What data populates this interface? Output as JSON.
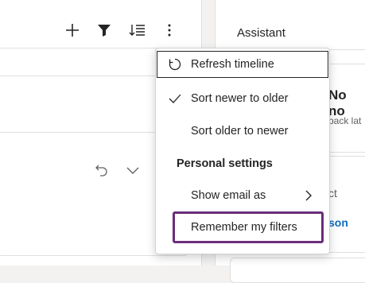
{
  "assistant": {
    "title": "Assistant",
    "card1_heading": "No no",
    "card1_subtext": "back lat",
    "card2_text": "ct",
    "card2_link": "son"
  },
  "menu": {
    "items": [
      {
        "label": "Refresh timeline",
        "icon": "refresh-icon"
      },
      {
        "label": "Sort newer to older",
        "icon": "checkmark-icon",
        "checked": true
      },
      {
        "label": "Sort older to newer"
      }
    ],
    "section_heading": "Personal settings",
    "show_email_label": "Show email as",
    "remember_filters_label": "Remember my filters"
  },
  "colors": {
    "accent": "#0f6cbd",
    "highlight": "#6b2d7a"
  }
}
